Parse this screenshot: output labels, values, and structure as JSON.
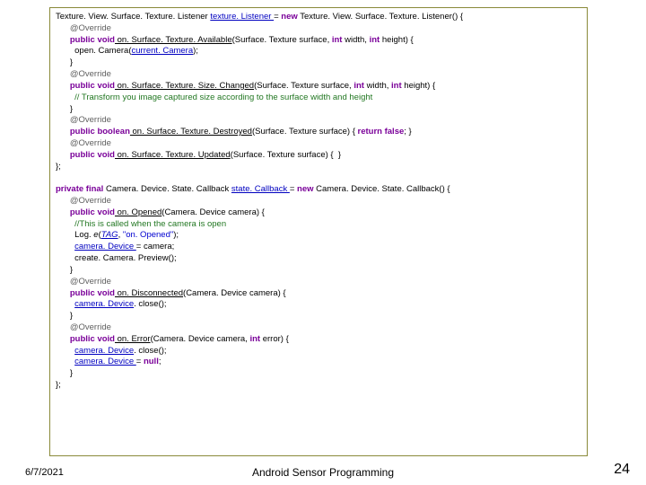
{
  "code": {
    "l1a": "Texture. View. Surface. Texture. Listener ",
    "l1b": "texture. Listener ",
    "l1c": "= ",
    "l1d": "new",
    "l1e": " Texture. View. Surface. Texture. Listener() {",
    "l2": "@Override",
    "l3a": "public void",
    "l3b": " on. Surface. Texture. Available",
    "l3c": "(Surface. Texture surface, ",
    "l3d": "int",
    "l3e": " width, ",
    "l3f": "int",
    "l3g": " height) {",
    "l4a": "open. Camera(",
    "l4b": "current. Camera",
    "l4c": ");",
    "l5": "}",
    "l6": "@Override",
    "l7a": "public void",
    "l7b": " on. Surface. Texture. Size. Changed",
    "l7c": "(Surface. Texture surface, ",
    "l7d": "int",
    "l7e": " width, ",
    "l7f": "int",
    "l7g": " height) {",
    "l8": "// Transform you image captured size according to the surface width and height",
    "l9": "}",
    "l10": "@Override",
    "l11a": "public boolean",
    "l11b": " on. Surface. Texture. Destroyed",
    "l11c": "(Surface. Texture surface) { ",
    "l11d": "return false",
    "l11e": "; }",
    "l12": "@Override",
    "l13a": "public void",
    "l13b": " on. Surface. Texture. Updated",
    "l13c": "(Surface. Texture surface) {  }",
    "l14": "};",
    "blank": " ",
    "l16a": "private final",
    "l16b": " Camera. Device. State. Callback ",
    "l16c": "state. Callback ",
    "l16d": "= ",
    "l16e": "new",
    "l16f": " Camera. Device. State. Callback() {",
    "l17": "@Override",
    "l18a": "public void",
    "l18b": " on. Opened",
    "l18c": "(Camera. Device camera) {",
    "l19": "//This is called when the camera is open",
    "l20a": "Log. ",
    "l20b": "e",
    "l20c": "(",
    "l20d": "TAG",
    "l20e": ", ",
    "l20f": "\"on. Opened\"",
    "l20g": ");",
    "l21a": "camera. Device ",
    "l21b": "= camera;",
    "l22": "create. Camera. Preview();",
    "l23": "}",
    "l24": "@Override",
    "l25a": "public void",
    "l25b": " on. Disconnected",
    "l25c": "(Camera. Device camera) {",
    "l26a": "camera. Device",
    "l26b": ". close();",
    "l27": "}",
    "l28": "@Override",
    "l29a": "public void",
    "l29b": " on. Error",
    "l29c": "(Camera. Device camera, ",
    "l29d": "int",
    "l29e": " error) {",
    "l30a": "camera. Device",
    "l30b": ". close();",
    "l31a": "camera. Device ",
    "l31b": "= ",
    "l31c": "null",
    "l31d": ";",
    "l32": "}",
    "l33": "};"
  },
  "indent1": "      ",
  "indent2": "        ",
  "footer": {
    "date": "6/7/2021",
    "title": "Android Sensor Programming",
    "page": "24"
  }
}
